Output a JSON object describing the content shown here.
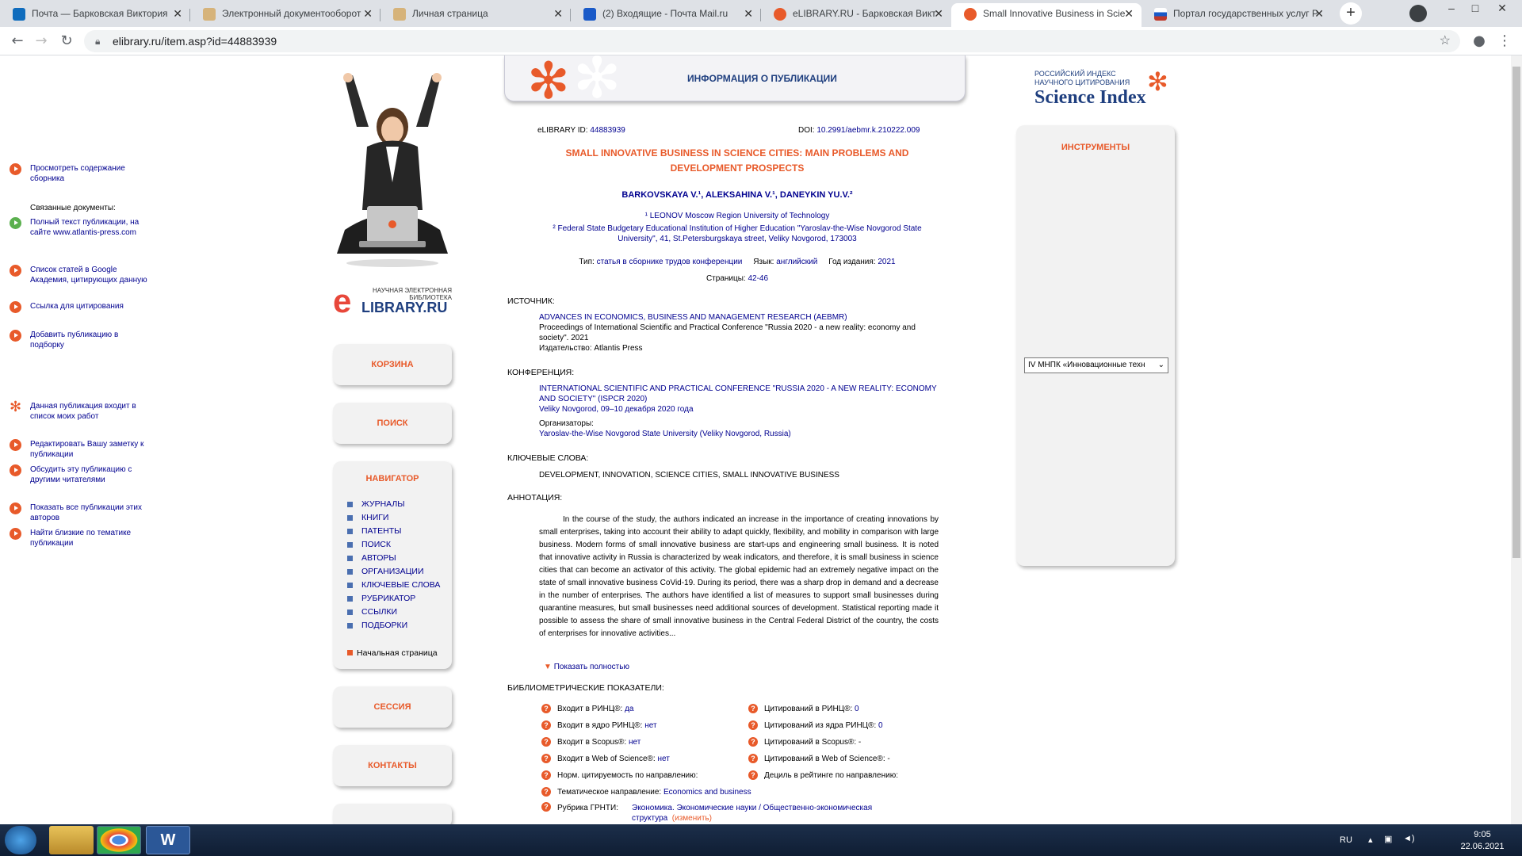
{
  "browser": {
    "tabs": [
      {
        "title": "Почта — Барковская Виктория",
        "icon_color": "#0f6cbd",
        "active": false
      },
      {
        "title": "Электронный документооборот",
        "icon_color": "#d6b37a",
        "active": false
      },
      {
        "title": "Личная страница",
        "icon_color": "#d6b37a",
        "active": false
      },
      {
        "title": "(2) Входящие - Почта Mail.ru",
        "icon_color": "#1a5ac8",
        "active": false
      },
      {
        "title": "eLIBRARY.RU - Барковская Викт",
        "icon_color": "#e85a2a",
        "active": false
      },
      {
        "title": "Small Innovative Business in Scie",
        "icon_color": "#e85a2a",
        "active": true
      },
      {
        "title": "Портал государственных услуг Р",
        "icon_color": "#c0392b",
        "active": false
      }
    ],
    "url": "elibrary.ru/item.asp?id=44883939"
  },
  "left": {
    "logo_small": "НАУЧНАЯ ЭЛЕКТРОННАЯ БИБЛИОТЕКА",
    "logo_brand": "LIBRARY.RU",
    "logo_e": "e",
    "cart": "КОРЗИНА",
    "search": "ПОИСК",
    "navigator_title": "НАВИГАТОР",
    "nav_items": [
      "ЖУРНАЛЫ",
      "КНИГИ",
      "ПАТЕНТЫ",
      "ПОИСК",
      "АВТОРЫ",
      "ОРГАНИЗАЦИИ",
      "КЛЮЧЕВЫЕ СЛОВА",
      "РУБРИКАТОР",
      "ССЫЛКИ",
      "ПОДБОРКИ"
    ],
    "home": "Начальная страница",
    "session": "СЕССИЯ",
    "contacts": "КОНТАКТЫ"
  },
  "center": {
    "header": "ИНФОРМАЦИЯ О ПУБЛИКАЦИИ",
    "id_label": "eLIBRARY ID:",
    "id_value": "44883939",
    "doi_label": "DOI:",
    "doi_value": "10.2991/aebmr.k.210222.009",
    "title": "SMALL INNOVATIVE BUSINESS IN SCIENCE CITIES: MAIN PROBLEMS AND DEVELOPMENT PROSPECTS",
    "authors": "BARKOVSKAYA V.¹, ALEKSAHINA V.¹, DANEYKIN YU.V.²",
    "aff1": "¹ LEONOV Moscow Region University of Technology",
    "aff2a": "² Federal State Budgetary Educational Institution of Higher Education \"Yaroslav-the-Wise Novgorod State",
    "aff2b": "University\", 41, St.Petersburgskaya street, Veliky Novgorod, 173003",
    "type_label": "Тип:",
    "type_value": "статья в сборнике трудов конференции",
    "lang_label": "Язык:",
    "lang_value": "английский",
    "year_label": "Год издания:",
    "year_value": "2021",
    "pages_label": "Страницы:",
    "pages_value": "42-46",
    "source_label": "ИСТОЧНИК:",
    "source_title": "ADVANCES IN ECONOMICS, BUSINESS AND MANAGEMENT RESEARCH (AEBMR)",
    "source_proc": "Proceedings of International Scientific and Practical Conference \"Russia 2020 - a new reality: economy and society\". 2021",
    "source_pub": "Издательство: Atlantis Press",
    "conf_label": "КОНФЕРЕНЦИЯ:",
    "conf_title": "INTERNATIONAL SCIENTIFIC AND PRACTICAL CONFERENCE \"RUSSIA 2020 - A NEW REALITY: ECONOMY AND SOCIETY\" (ISPCR 2020)",
    "conf_place": "Veliky Novgorod, 09–10 декабря 2020 года",
    "org_label": "Организаторы:",
    "org_value": "Yaroslav-the-Wise Novgorod State University (Veliky Novgorod, Russia)",
    "kw_label": "КЛЮЧЕВЫЕ СЛОВА:",
    "kw_value": "DEVELOPMENT, INNOVATION, SCIENCE CITIES, SMALL INNOVATIVE BUSINESS",
    "abs_label": "АННОТАЦИЯ:",
    "abstract": "In the course of the study, the authors indicated an increase in the importance of creating innovations by small enterprises, taking into account their ability to adapt quickly, flexibility, and mobility in comparison with large business. Modern forms of small innovative business are start-ups and engineering small business. It is noted that innovative activity in Russia is characterized by weak indicators, and therefore, it is small business in science cities that can become an activator of this activity. The global epidemic had an extremely negative impact on the state of small innovative business CoVid-19. During its period, there was a sharp drop in demand and a decrease in the number of enterprises. The authors have identified a list of measures to support small businesses during quarantine measures, but small businesses need additional sources of development. Statistical reporting made it possible to assess the share of small innovative business in the Central Federal District of the country, the costs of enterprises for innovative activities...",
    "show_full": "Показать полностью",
    "bib_label": "БИБЛИОМЕТРИЧЕСКИЕ ПОКАЗАТЕЛИ:",
    "bib_left": [
      {
        "label": "Входит в РИНЦ®:",
        "value": "да"
      },
      {
        "label": "Входит в ядро РИНЦ®:",
        "value": "нет"
      },
      {
        "label": "Входит в Scopus®:",
        "value": "нет"
      },
      {
        "label": "Входит в Web of Science®:",
        "value": "нет"
      },
      {
        "label": "Норм. цитируемость по направлению:",
        "value": ""
      }
    ],
    "bib_right": [
      {
        "label": "Цитирований в РИНЦ®:",
        "value": "0"
      },
      {
        "label": "Цитирований из ядра РИНЦ®:",
        "value": "0"
      },
      {
        "label": "Цитирований в Scopus®:",
        "value": "-"
      },
      {
        "label": "Цитирований в Web of Science®:",
        "value": "-"
      },
      {
        "label": "Дециль в рейтинге по направлению:",
        "value": ""
      }
    ],
    "theme_label": "Тематическое направление:",
    "theme_value": "Economics and business",
    "grnti_label": "Рубрика ГРНТИ:",
    "grnti_value1": "Экономика. Экономические науки",
    "grnti_sep": "/",
    "grnti_value2": "Общественно-экономическая",
    "grnti_value3": "структура",
    "grnti_change": "(изменить)"
  },
  "right": {
    "logo_line1": "РОССИЙСКИЙ ИНДЕКС",
    "logo_line2": "НАУЧНОГО ЦИТИРОВАНИЯ",
    "logo_main": "Science Index",
    "tools_title": "ИНСТРУМЕНТЫ",
    "t_contents": "Просмотреть содержание сборника",
    "related_label": "Связанные документы:",
    "t_fulltext": "Полный текст публикации, на сайте www.atlantis-press.com",
    "t_google": "Список статей в Google Академия, цитирующих данную",
    "t_cite": "Ссылка для цитирования",
    "t_add": "Добавить публикацию в подборку",
    "select_value": "IV МНПК «Инновационные техн",
    "t_mywork": "Данная публикация входит в список моих работ",
    "t_note": "Редактировать Вашу заметку к публикации",
    "t_discuss": "Обсудить эту публикацию с другими читателями",
    "t_allpubs": "Показать все публикации этих авторов",
    "t_similar": "Найти близкие по тематике публикации"
  },
  "taskbar": {
    "lang": "RU",
    "time": "9:05",
    "date": "22.06.2021"
  }
}
